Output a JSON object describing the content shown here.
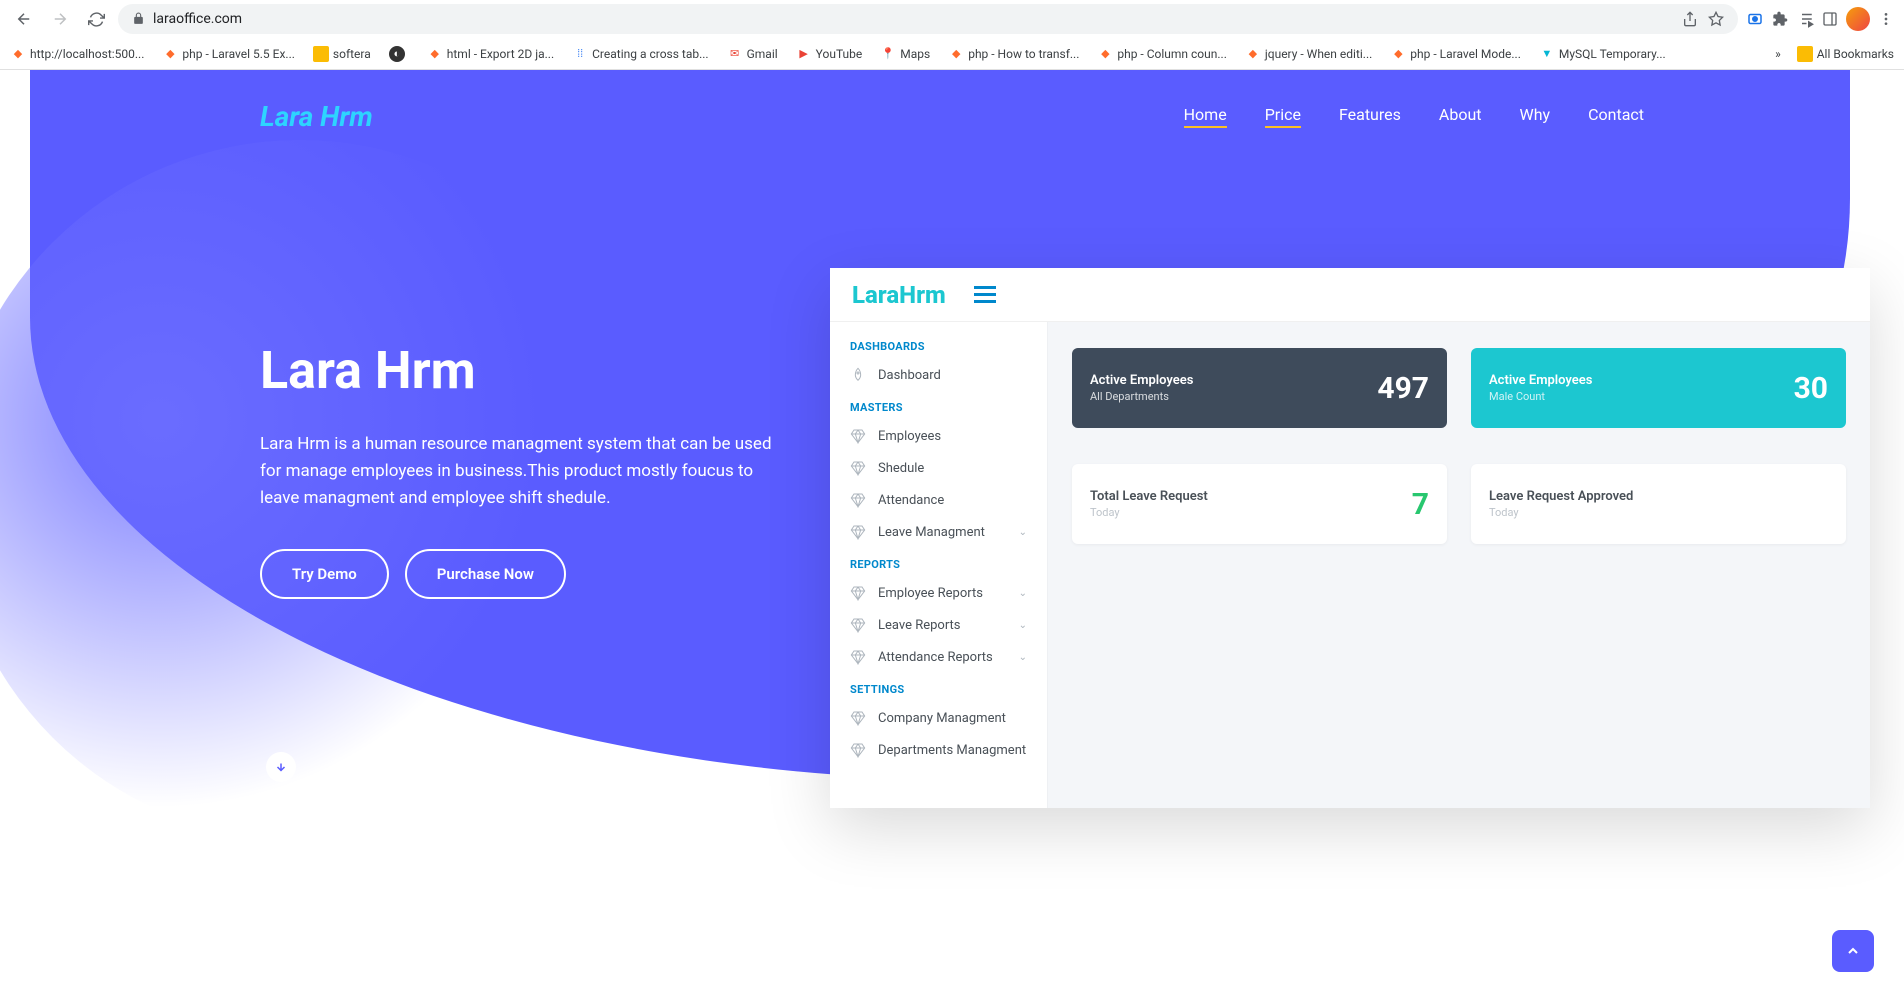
{
  "browser": {
    "url": "laraoffice.com",
    "bookmarks": [
      {
        "label": "http://localhost:500...",
        "icon": "orange"
      },
      {
        "label": "php - Laravel 5.5 Ex...",
        "icon": "orange"
      },
      {
        "label": "softera",
        "icon": "yellow"
      },
      {
        "label": "",
        "icon": "dark"
      },
      {
        "label": "html - Export 2D ja...",
        "icon": "orange"
      },
      {
        "label": "Creating a cross tab...",
        "icon": "dots"
      },
      {
        "label": "Gmail",
        "icon": "gmail"
      },
      {
        "label": "YouTube",
        "icon": "youtube"
      },
      {
        "label": "Maps",
        "icon": "maps"
      },
      {
        "label": "php - How to transf...",
        "icon": "orange"
      },
      {
        "label": "php - Column coun...",
        "icon": "orange"
      },
      {
        "label": "jquery - When editi...",
        "icon": "orange"
      },
      {
        "label": "php - Laravel Mode...",
        "icon": "orange"
      },
      {
        "label": "MySQL Temporary...",
        "icon": "teal"
      }
    ],
    "all_bookmarks": "All Bookmarks"
  },
  "site": {
    "logo": "Lara Hrm",
    "nav": [
      "Home",
      "Price",
      "Features",
      "About",
      "Why",
      "Contact"
    ]
  },
  "hero": {
    "title": "Lara Hrm",
    "desc": "Lara Hrm is a human resource managment system that can be used for manage employees in business.This product mostly foucus to leave managment and employee shift shedule.",
    "btn1": "Try Demo",
    "btn2": "Purchase Now"
  },
  "preview": {
    "logo": "LaraHrm",
    "sidebar": {
      "sections": [
        {
          "title": "DASHBOARDS",
          "items": [
            {
              "label": "Dashboard",
              "icon": "rocket"
            }
          ]
        },
        {
          "title": "MASTERS",
          "items": [
            {
              "label": "Employees",
              "icon": "diamond"
            },
            {
              "label": "Shedule",
              "icon": "diamond"
            },
            {
              "label": "Attendance",
              "icon": "diamond"
            },
            {
              "label": "Leave Managment",
              "icon": "diamond",
              "chev": true
            }
          ]
        },
        {
          "title": "REPORTS",
          "items": [
            {
              "label": "Employee Reports",
              "icon": "diamond",
              "chev": true
            },
            {
              "label": "Leave Reports",
              "icon": "diamond",
              "chev": true
            },
            {
              "label": "Attendance Reports",
              "icon": "diamond",
              "chev": true
            }
          ]
        },
        {
          "title": "SETTINGS",
          "items": [
            {
              "label": "Company Managment",
              "icon": "diamond"
            },
            {
              "label": "Departments Managment",
              "icon": "diamond"
            }
          ]
        }
      ]
    },
    "cards": [
      {
        "title": "Active Employees",
        "sub": "All Departments",
        "value": "497",
        "style": "dark"
      },
      {
        "title": "Active Employees",
        "sub": "Male Count",
        "value": "30",
        "style": "cyan"
      },
      {
        "title": "Total Leave Request",
        "sub": "Today",
        "value": "7",
        "style": "white-green"
      },
      {
        "title": "Leave Request Approved",
        "sub": "Today",
        "value": "",
        "style": "white"
      }
    ]
  }
}
